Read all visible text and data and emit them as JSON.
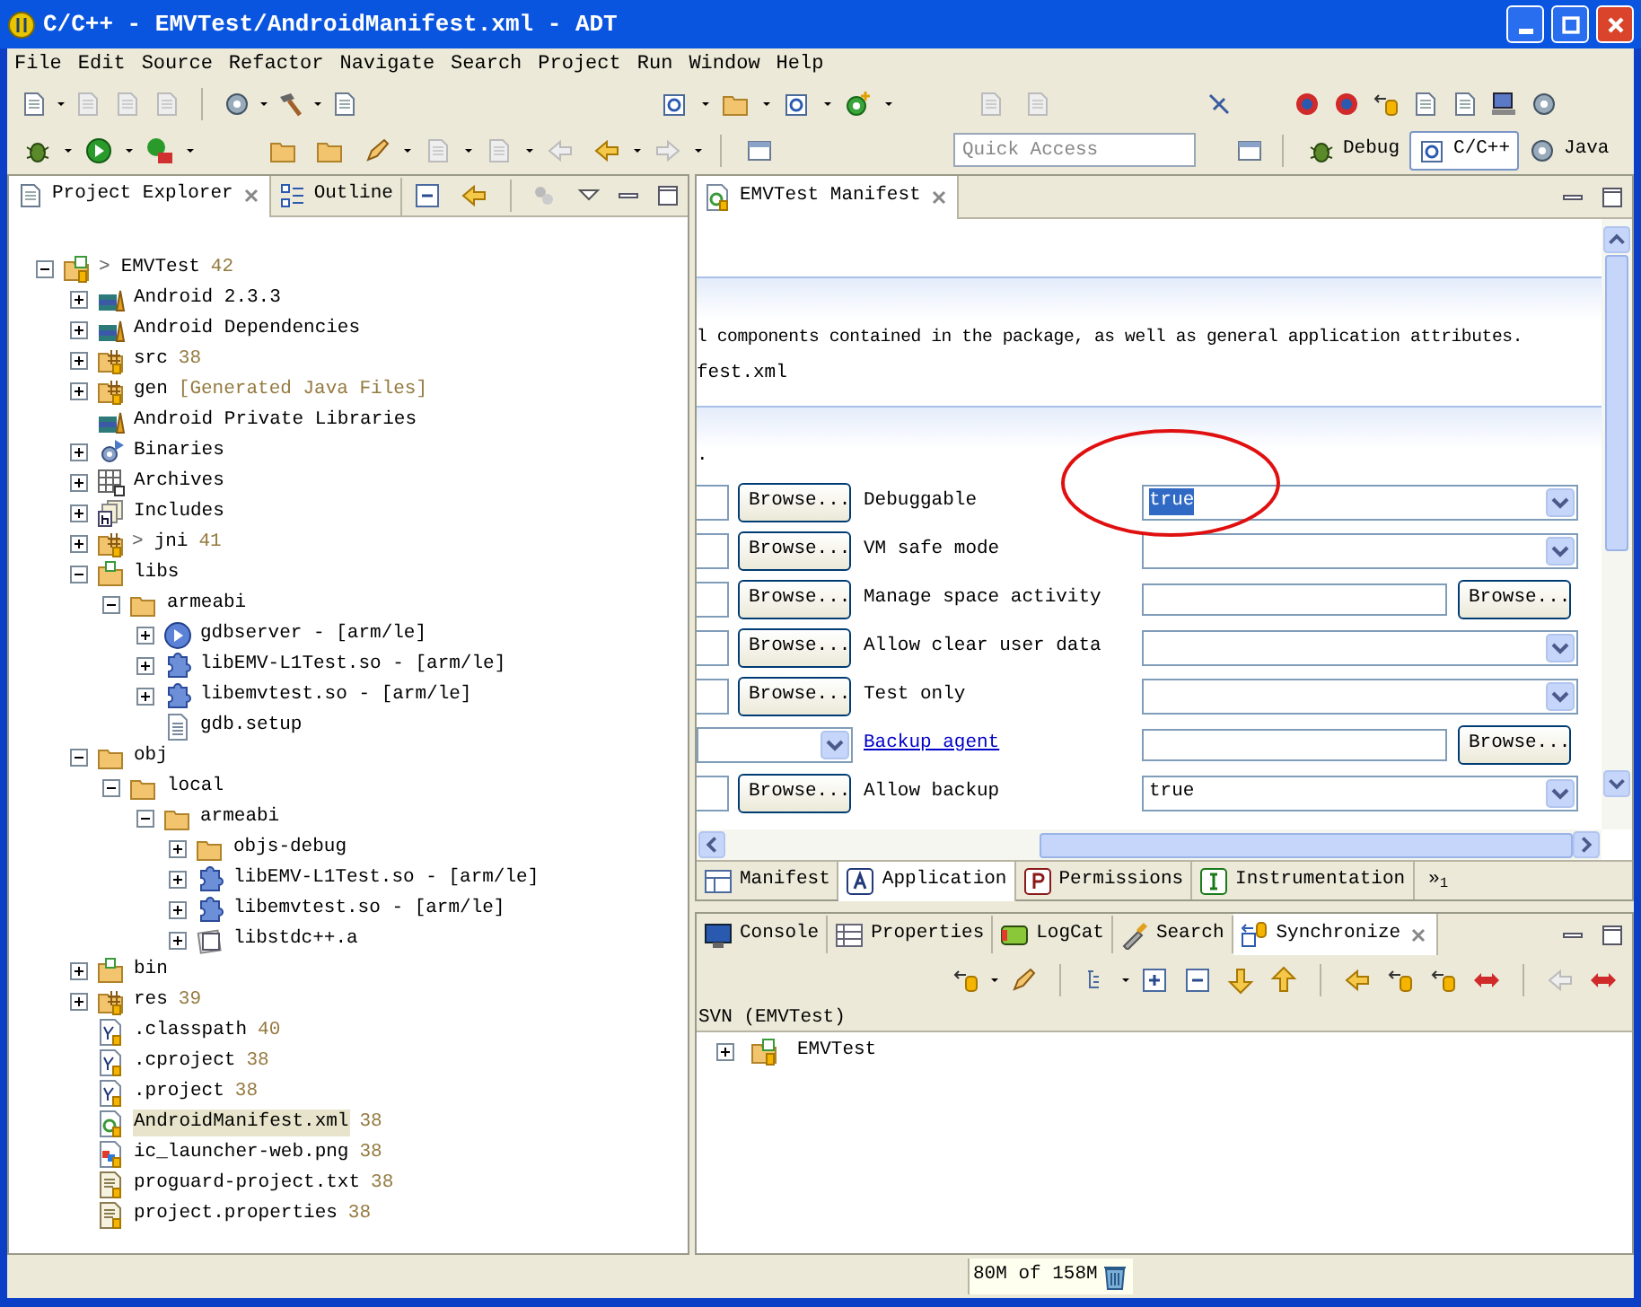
{
  "window": {
    "title": "C/C++ - EMVTest/AndroidManifest.xml - ADT"
  },
  "menu": [
    "File",
    "Edit",
    "Source",
    "Refactor",
    "Navigate",
    "Search",
    "Project",
    "Run",
    "Window",
    "Help"
  ],
  "toolbar": {
    "quick_access_placeholder": "Quick Access",
    "perspectives": [
      {
        "label": "Debug",
        "selected": false
      },
      {
        "label": "C/C++",
        "selected": true
      },
      {
        "label": "Java",
        "selected": false
      }
    ]
  },
  "left_panel": {
    "tabs": [
      {
        "label": "Project Explorer",
        "selected": true,
        "closable": true
      },
      {
        "label": "Outline",
        "selected": false,
        "closable": false
      }
    ],
    "tree": [
      {
        "label": "EMVTest",
        "prefix": ">",
        "count": "42",
        "kind": "project",
        "expanded": true,
        "selected": false,
        "children": [
          {
            "label": "Android 2.3.3",
            "kind": "library",
            "expanded": false,
            "selected": false
          },
          {
            "label": "Android Dependencies",
            "kind": "library",
            "expanded": false,
            "selected": false
          },
          {
            "label": "src",
            "count": "38",
            "kind": "source-folder",
            "expanded": false,
            "selected": false
          },
          {
            "label": "gen",
            "note": "[Generated Java Files]",
            "kind": "source-folder",
            "expanded": false,
            "selected": false
          },
          {
            "label": "Android Private Libraries",
            "kind": "library",
            "selected": false
          },
          {
            "label": "Binaries",
            "kind": "binaries",
            "expanded": false,
            "selected": false
          },
          {
            "label": "Archives",
            "kind": "archives",
            "expanded": false,
            "selected": false
          },
          {
            "label": "Includes",
            "kind": "includes",
            "expanded": false,
            "selected": false
          },
          {
            "label": "jni",
            "prefix": ">",
            "count": "41",
            "kind": "source-folder",
            "expanded": false,
            "selected": false
          },
          {
            "label": "libs",
            "kind": "project-folder",
            "expanded": true,
            "selected": false,
            "children": [
              {
                "label": "armeabi",
                "kind": "folder",
                "expanded": true,
                "selected": false,
                "children": [
                  {
                    "label": "gdbserver - [arm/le]",
                    "kind": "executable",
                    "expanded": false,
                    "selected": false
                  },
                  {
                    "label": "libEMV-L1Test.so - [arm/le]",
                    "kind": "shared-lib",
                    "expanded": false,
                    "selected": false
                  },
                  {
                    "label": "libemvtest.so - [arm/le]",
                    "kind": "shared-lib",
                    "expanded": false,
                    "selected": false
                  },
                  {
                    "label": "gdb.setup",
                    "kind": "file",
                    "selected": false
                  }
                ]
              }
            ]
          },
          {
            "label": "obj",
            "kind": "folder",
            "expanded": true,
            "selected": false,
            "children": [
              {
                "label": "local",
                "kind": "folder",
                "expanded": true,
                "selected": false,
                "children": [
                  {
                    "label": "armeabi",
                    "kind": "folder",
                    "expanded": true,
                    "selected": false,
                    "children": [
                      {
                        "label": "objs-debug",
                        "kind": "folder",
                        "expanded": false,
                        "selected": false
                      },
                      {
                        "label": "libEMV-L1Test.so - [arm/le]",
                        "kind": "shared-lib",
                        "expanded": false,
                        "selected": false
                      },
                      {
                        "label": "libemvtest.so - [arm/le]",
                        "kind": "shared-lib",
                        "expanded": false,
                        "selected": false
                      },
                      {
                        "label": "libstdc++.a",
                        "kind": "archive-file",
                        "expanded": false,
                        "selected": false
                      }
                    ]
                  }
                ]
              }
            ]
          },
          {
            "label": "bin",
            "kind": "project-folder",
            "expanded": false,
            "selected": false
          },
          {
            "label": "res",
            "count": "39",
            "kind": "source-folder",
            "expanded": false,
            "selected": false
          },
          {
            "label": ".classpath",
            "count": "40",
            "kind": "xml-file",
            "selected": false
          },
          {
            "label": ".cproject",
            "count": "38",
            "kind": "xml-file",
            "selected": false
          },
          {
            "label": ".project",
            "count": "38",
            "kind": "xml-file",
            "selected": false
          },
          {
            "label": "AndroidManifest.xml",
            "count": "38",
            "kind": "manifest",
            "selected": true
          },
          {
            "label": "ic_launcher-web.png",
            "count": "38",
            "kind": "image",
            "selected": false
          },
          {
            "label": "proguard-project.txt",
            "count": "38",
            "kind": "text-file",
            "selected": false
          },
          {
            "label": "project.properties",
            "count": "38",
            "kind": "text-file",
            "selected": false
          }
        ]
      }
    ]
  },
  "editor": {
    "tab": {
      "label": "EMVTest Manifest",
      "closable": true
    },
    "description": "l components contained in the package, as well as general application attributes.",
    "file_line": "fest.xml",
    "section_text": ".",
    "rows": [
      {
        "left": {
          "kind": "browse",
          "button": "Browse..."
        },
        "label": "Debuggable",
        "link": false,
        "kind": "combo",
        "value": "true",
        "value_selected": true
      },
      {
        "left": {
          "kind": "browse",
          "button": "Browse..."
        },
        "label": "VM safe mode",
        "link": false,
        "kind": "combo"
      },
      {
        "left": {
          "kind": "browse",
          "button": "Browse..."
        },
        "label": "Manage space activity",
        "link": false,
        "kind": "text_browse",
        "button": "Browse..."
      },
      {
        "left": {
          "kind": "browse",
          "button": "Browse..."
        },
        "label": "Allow clear user data",
        "link": false,
        "kind": "combo"
      },
      {
        "left": {
          "kind": "browse",
          "button": "Browse..."
        },
        "label": "Test only",
        "link": false,
        "kind": "combo"
      },
      {
        "left": {
          "kind": "combo"
        },
        "label": "Backup agent",
        "link": true,
        "kind": "text_browse",
        "button": "Browse..."
      },
      {
        "left": {
          "kind": "browse",
          "button": "Browse..."
        },
        "label": "Allow backup",
        "link": false,
        "kind": "combo",
        "value": "true",
        "value_selected": false
      }
    ],
    "page_tabs": [
      {
        "label": "Manifest",
        "selected": false
      },
      {
        "label": "Application",
        "selected": true
      },
      {
        "label": "Permissions",
        "selected": false
      },
      {
        "label": "Instrumentation",
        "selected": false
      }
    ],
    "overflow": "»$_{1}$"
  },
  "bottom_panel": {
    "tabs": [
      {
        "label": "Console",
        "selected": false,
        "closable": false
      },
      {
        "label": "Properties",
        "selected": false,
        "closable": false
      },
      {
        "label": "LogCat",
        "selected": false,
        "closable": false
      },
      {
        "label": "Search",
        "selected": false,
        "closable": false
      },
      {
        "label": "Synchronize",
        "selected": true,
        "closable": true
      }
    ],
    "header": "SVN (EMVTest)",
    "tree": [
      {
        "label": "EMVTest",
        "expanded": false
      }
    ]
  },
  "status_bar": {
    "memory": "80M of 158M"
  }
}
